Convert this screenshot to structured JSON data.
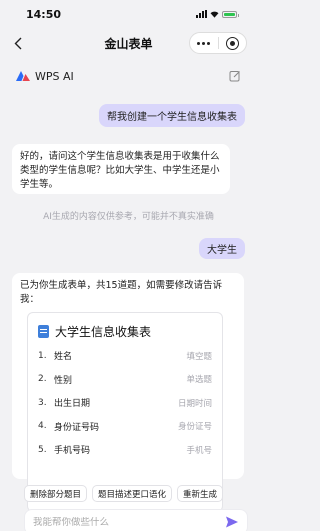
{
  "status_bar": {
    "time": "14:50"
  },
  "nav": {
    "title": "金山表单"
  },
  "ai_header": {
    "name": "WPS AI"
  },
  "messages": {
    "user_1": "帮我创建一个学生信息收集表",
    "ai_1": "好的，请问这个学生信息收集表是用于收集什么类型的学生信息呢？比如大学生、中学生还是小学生等。",
    "disclaimer": "AI生成的内容仅供参考，可能并不真实准确",
    "user_2": "大学生",
    "ai_2": "已为你生成表单，共15道题，如需要修改请告诉我："
  },
  "form": {
    "title": "大学生信息收集表",
    "fields": [
      {
        "num": "1.",
        "name": "姓名",
        "type": "填空题"
      },
      {
        "num": "2.",
        "name": "性别",
        "type": "单选题"
      },
      {
        "num": "3.",
        "name": "出生日期",
        "type": "日期时间"
      },
      {
        "num": "4.",
        "name": "身份证号码",
        "type": "身份证号"
      },
      {
        "num": "5.",
        "name": "手机号码",
        "type": "手机号"
      }
    ]
  },
  "suggestions": [
    "删除部分题目",
    "题目描述更口语化",
    "重新生成"
  ],
  "input": {
    "placeholder": "我能帮你做些什么"
  },
  "colors": {
    "accent": "#7b68ee",
    "user_bubble": "#d9d6fb",
    "logo_blue": "#2b6cf6"
  }
}
